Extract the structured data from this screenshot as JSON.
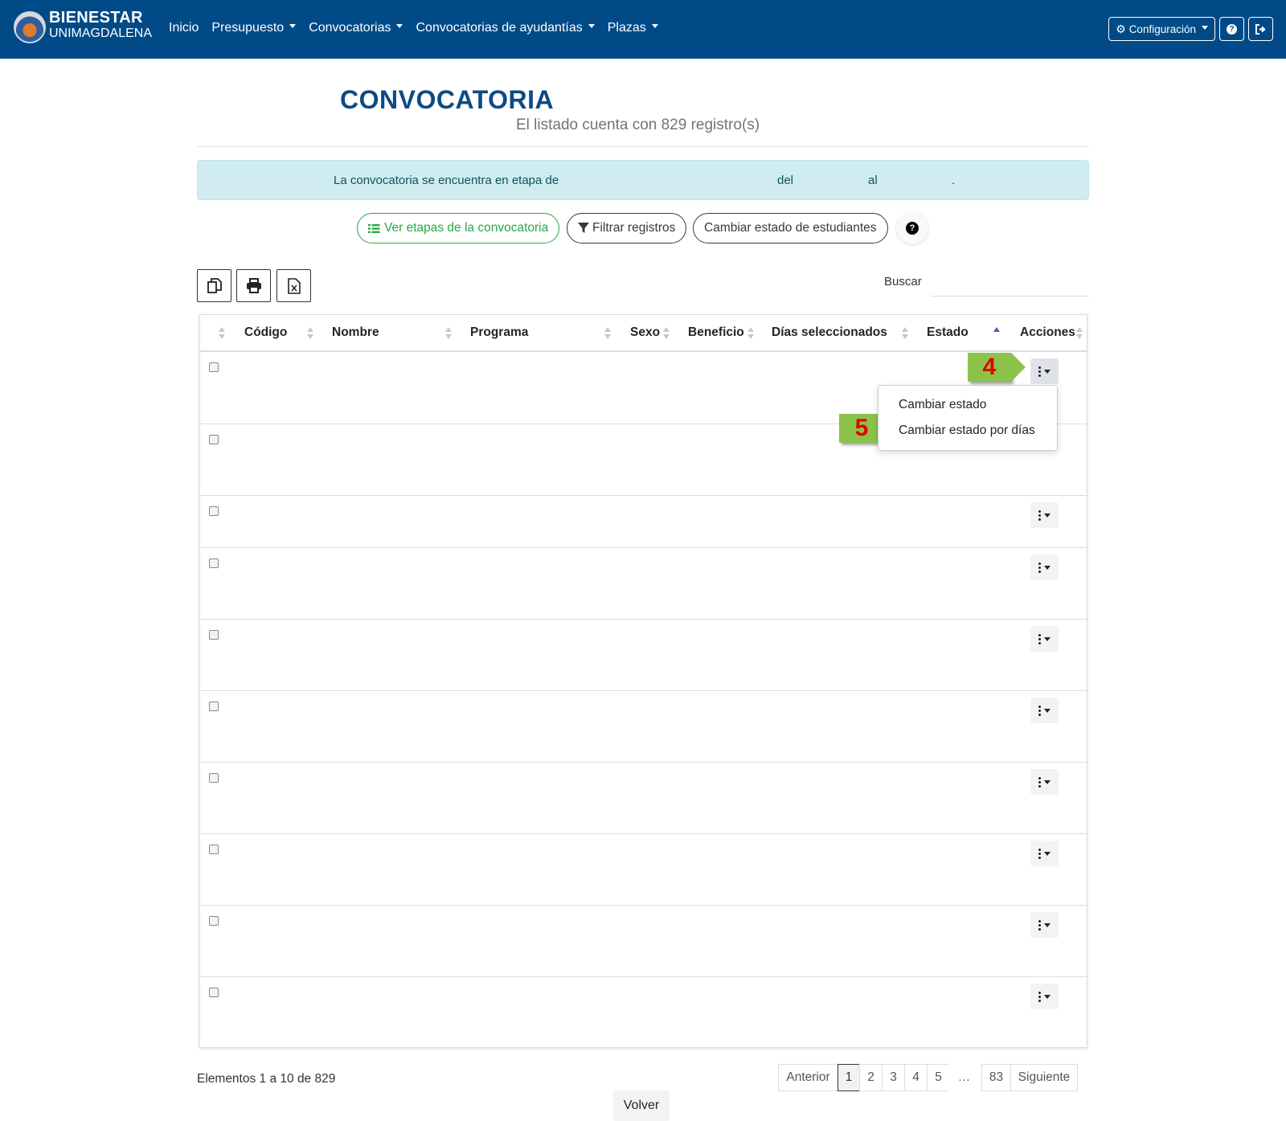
{
  "navbar": {
    "brand_top": "BIENESTAR",
    "brand_bottom": "UNIMAGDALENA",
    "links": [
      "Inicio",
      "Presupuesto",
      "Convocatorias",
      "Convocatorias de ayudantías",
      "Plazas"
    ],
    "config_label": "Configuración",
    "bg_color": "#004a87"
  },
  "header": {
    "title": "CONVOCATORIA",
    "subtitle": "El listado cuenta con 829 registro(s)"
  },
  "alert": {
    "prefix": "La convocatoria se encuentra en etapa de",
    "del": "del",
    "al": "al",
    "dot": "."
  },
  "actions": {
    "stages": "Ver etapas de la convocatoria",
    "filter": "Filtrar registros",
    "change_state": "Cambiar estado de estudiantes"
  },
  "search": {
    "label": "Buscar",
    "value": ""
  },
  "table": {
    "columns": [
      "Código",
      "Nombre",
      "Programa",
      "Sexo",
      "Beneficio",
      "Días seleccionados",
      "Estado",
      "Acciones"
    ],
    "row_count": 10,
    "sorted_column": "Estado"
  },
  "dropdown": {
    "items": [
      "Cambiar estado",
      "Cambiar estado por días"
    ]
  },
  "callouts": [
    "4",
    "5"
  ],
  "pagination": {
    "info": "Elementos 1 a 10 de 829",
    "prev": "Anterior",
    "pages": [
      "1",
      "2",
      "3",
      "4",
      "5"
    ],
    "ellipsis": "…",
    "last": "83",
    "next": "Siguiente",
    "current": "1"
  },
  "back_label": "Volver"
}
